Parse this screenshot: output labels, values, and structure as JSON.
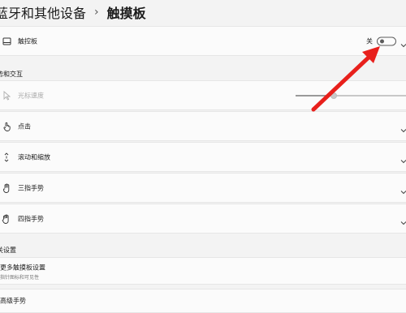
{
  "header": {
    "breadcrumb_parent": "蓝牙和其他设备",
    "separator": "›",
    "current": "触摸板"
  },
  "touchpad_row": {
    "label": "触控板",
    "toggle_state_text": "关",
    "toggle_on": false
  },
  "gestures_section": {
    "heading": "势和交互",
    "rows": [
      {
        "label": "光标速度",
        "disabled": true
      },
      {
        "label": "点击"
      },
      {
        "label": "滚动和缩放"
      },
      {
        "label": "三指手势"
      },
      {
        "label": "四指手势"
      }
    ],
    "cursor_speed_level": 0.35
  },
  "related_section": {
    "heading": "关设置",
    "more_settings_title": "更多触摸板设置",
    "more_settings_subtitle": "指针图标和可见性",
    "advanced_gestures": "高级手势"
  },
  "colors": {
    "annotation_arrow": "#e8201c",
    "background": "#f3f3f3",
    "card": "#fbfbfb"
  }
}
